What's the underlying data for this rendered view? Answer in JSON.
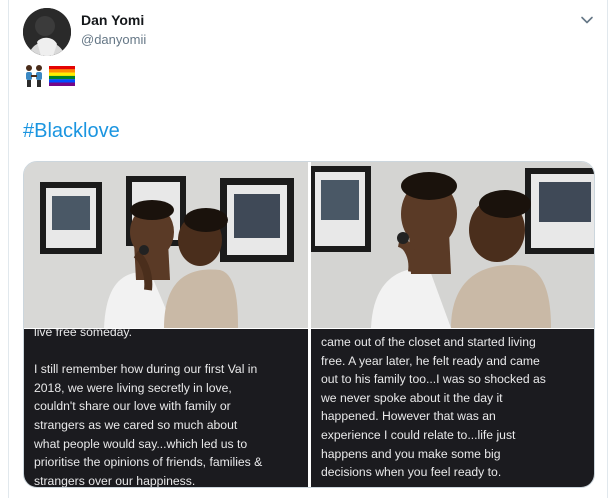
{
  "tweet": {
    "author_name": "Dan Yomi",
    "author_handle": "@danyomii",
    "emoji": "👬🏿🏳️‍🌈",
    "hashtag": "#Blacklove",
    "menu_icon": "chevron-down-icon"
  },
  "media": {
    "photos": [
      {
        "description_icon": "photo-couple-kissing-gallery-wall"
      },
      {
        "description_icon": "photo-couple-kissing-closeup"
      }
    ],
    "text_images": [
      {
        "lines": "live free someday.\n\nI still remember how during our first Val in\n2018, we were living secretly in love,\ncouldn't share our love with family or\nstrangers as we cared so much about\nwhat people would say...which led us to\nprioritise the opinions of friends, families &\nstrangers over our happiness."
      },
      {
        "lines": "came out of the closet and started living\nfree. A year later, he felt ready and came\nout to his family too...I was so shocked as\nwe never spoke about it the day it\nhappened. However that was an\nexperience I could relate to...life just\nhappens and you make some big\ndecisions when you feel ready to."
      }
    ]
  },
  "colors": {
    "hashtag": "#1b95e0",
    "name": "#14171a",
    "handle": "#657786",
    "text_image_bg": "#1b1b1f"
  }
}
